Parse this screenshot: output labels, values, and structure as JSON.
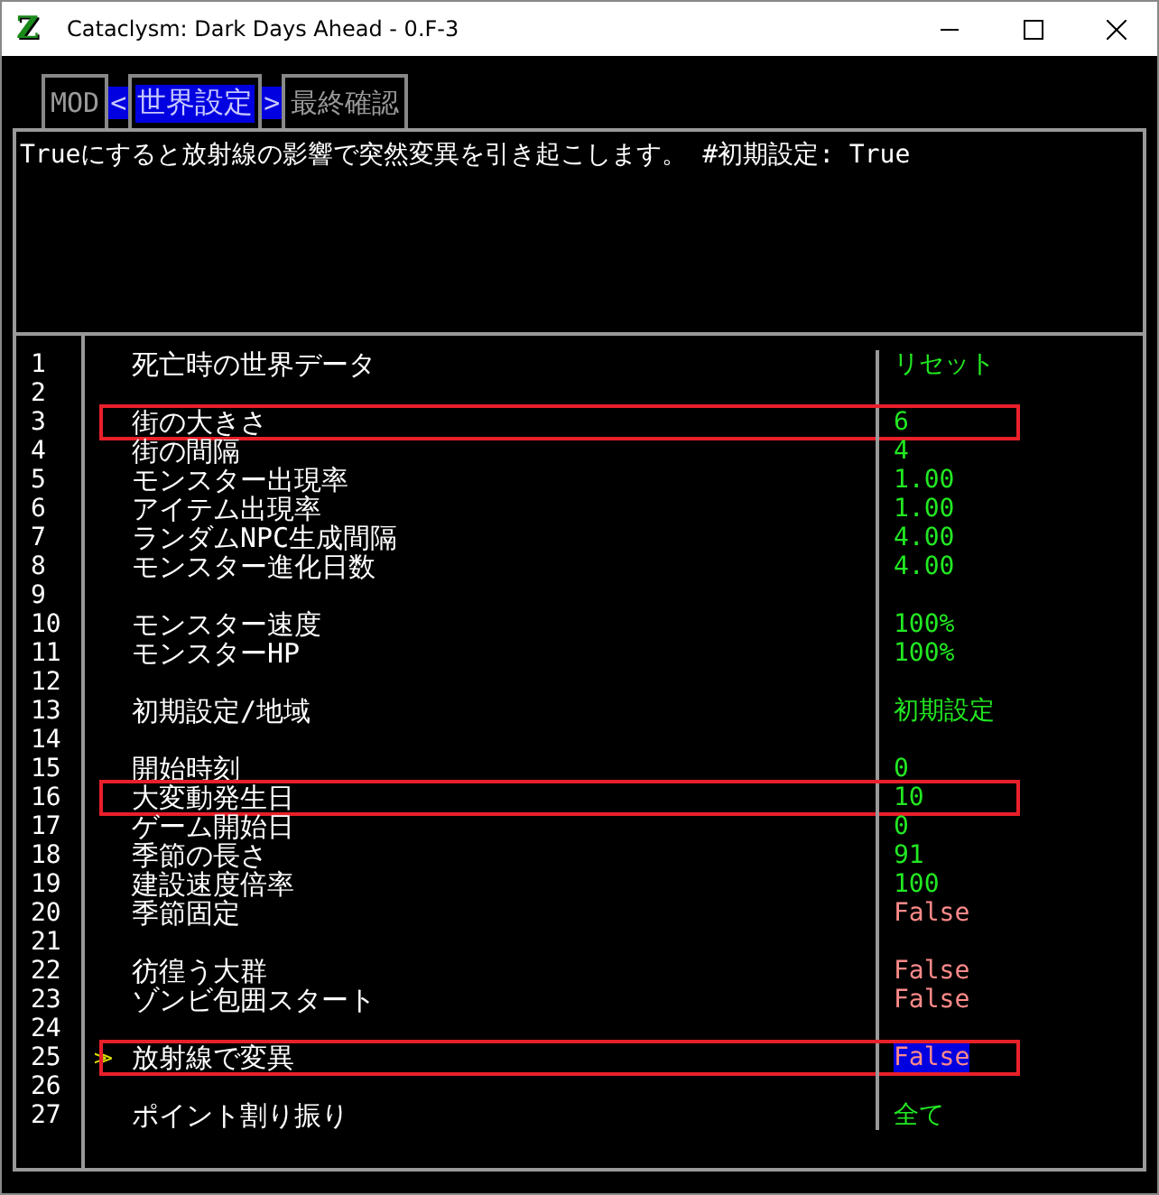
{
  "window": {
    "title": "Cataclysm: Dark Days Ahead - 0.F-3",
    "logo": "Z"
  },
  "tabs": [
    {
      "label": "MOD",
      "selected": false
    },
    {
      "label": "世界設定",
      "selected": true
    },
    {
      "label": "最終確認",
      "selected": false
    }
  ],
  "prev_arrow": "<",
  "next_arrow": ">",
  "description": "Trueにすると放射線の影響で突然変異を引き起こします。 #初期設定: True",
  "cursor": ">>",
  "rows": [
    {
      "number": "1",
      "name": "死亡時の世界データ",
      "value": "リセット",
      "kind": "text",
      "selected": false,
      "annotated": false
    },
    {
      "number": "2",
      "selected": false,
      "annotated": false
    },
    {
      "number": "3",
      "name": "街の大きさ",
      "value": "6",
      "kind": "text",
      "selected": false,
      "annotated": true
    },
    {
      "number": "4",
      "name": "街の間隔",
      "value": "4",
      "kind": "text",
      "selected": false,
      "annotated": false
    },
    {
      "number": "5",
      "name": "モンスター出現率",
      "value": "1.00",
      "kind": "text",
      "selected": false,
      "annotated": false
    },
    {
      "number": "6",
      "name": "アイテム出現率",
      "value": "1.00",
      "kind": "text",
      "selected": false,
      "annotated": false
    },
    {
      "number": "7",
      "name": "ランダムNPC生成間隔",
      "value": "4.00",
      "kind": "text",
      "selected": false,
      "annotated": false
    },
    {
      "number": "8",
      "name": "モンスター進化日数",
      "value": "4.00",
      "kind": "text",
      "selected": false,
      "annotated": false
    },
    {
      "number": "9",
      "selected": false,
      "annotated": false
    },
    {
      "number": "10",
      "name": "モンスター速度",
      "value": "100%",
      "kind": "text",
      "selected": false,
      "annotated": false
    },
    {
      "number": "11",
      "name": "モンスターHP",
      "value": "100%",
      "kind": "text",
      "selected": false,
      "annotated": false
    },
    {
      "number": "12",
      "selected": false,
      "annotated": false
    },
    {
      "number": "13",
      "name": "初期設定/地域",
      "value": "初期設定",
      "kind": "text",
      "selected": false,
      "annotated": false
    },
    {
      "number": "14",
      "selected": false,
      "annotated": false
    },
    {
      "number": "15",
      "name": "開始時刻",
      "value": "0",
      "kind": "text",
      "selected": false,
      "annotated": false
    },
    {
      "number": "16",
      "name": "大変動発生日",
      "value": "10",
      "kind": "text",
      "selected": false,
      "annotated": true
    },
    {
      "number": "17",
      "name": "ゲーム開始日",
      "value": "0",
      "kind": "text",
      "selected": false,
      "annotated": false
    },
    {
      "number": "18",
      "name": "季節の長さ",
      "value": "91",
      "kind": "text",
      "selected": false,
      "annotated": false
    },
    {
      "number": "19",
      "name": "建設速度倍率",
      "value": "100",
      "kind": "text",
      "selected": false,
      "annotated": false
    },
    {
      "number": "20",
      "name": "季節固定",
      "value": "False",
      "kind": "boolean",
      "selected": false,
      "annotated": false
    },
    {
      "number": "21",
      "selected": false,
      "annotated": false
    },
    {
      "number": "22",
      "name": "彷徨う大群",
      "value": "False",
      "kind": "boolean",
      "selected": false,
      "annotated": false
    },
    {
      "number": "23",
      "name": "ゾンビ包囲スタート",
      "value": "False",
      "kind": "boolean",
      "selected": false,
      "annotated": false
    },
    {
      "number": "24",
      "selected": false,
      "annotated": false
    },
    {
      "number": "25",
      "name": "放射線で変異",
      "value": "False",
      "kind": "boolean",
      "selected": true,
      "annotated": true
    },
    {
      "number": "26",
      "selected": false,
      "annotated": false
    },
    {
      "number": "27",
      "name": "ポイント割り振り",
      "value": "全て",
      "kind": "text",
      "selected": false,
      "annotated": false
    }
  ]
}
